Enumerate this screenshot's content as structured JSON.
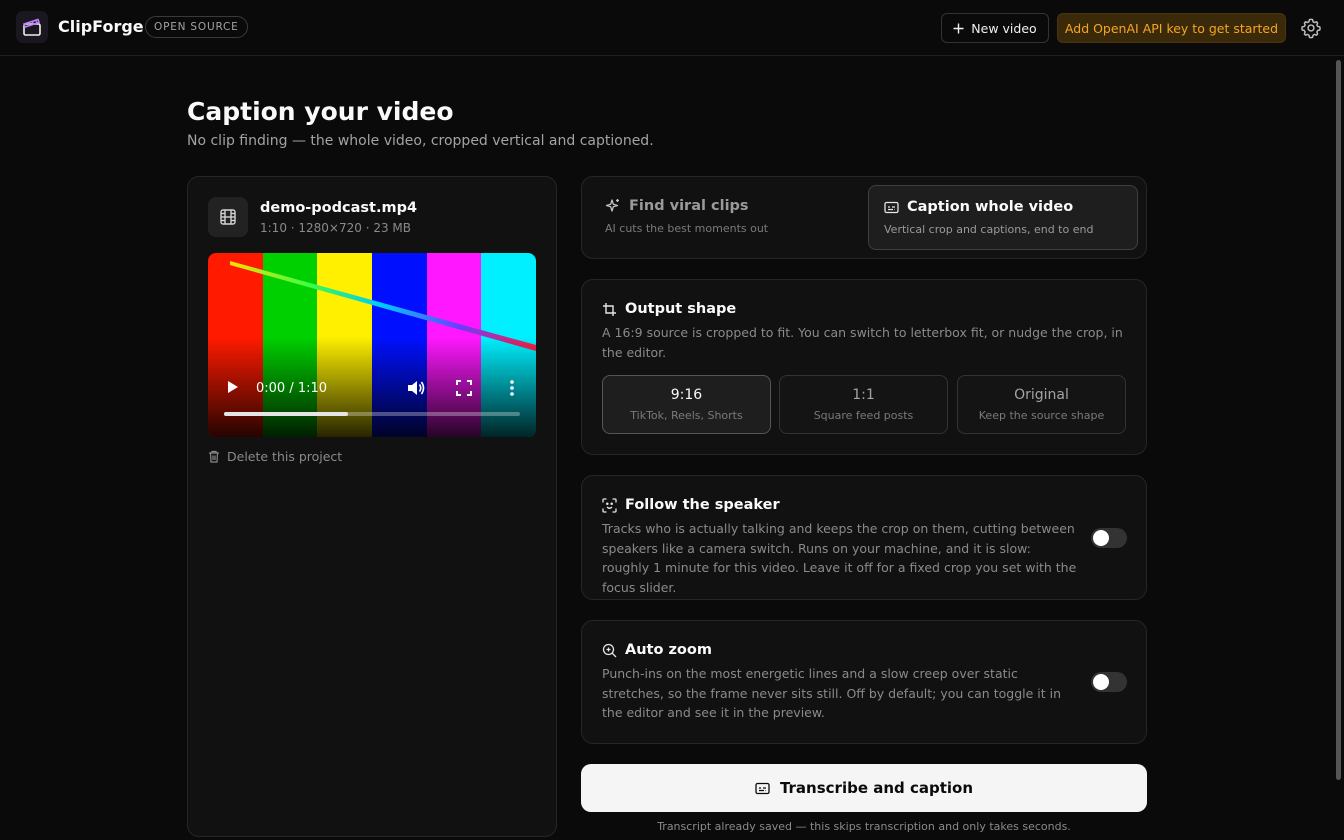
{
  "header": {
    "brand": "ClipForge",
    "badge": "OPEN SOURCE",
    "new_video_label": "New video",
    "api_key_label": "Add OpenAI API key to get started"
  },
  "page": {
    "title": "Caption your video",
    "subtitle": "No clip finding — the whole video, cropped vertical and captioned."
  },
  "file": {
    "name": "demo-podcast.mp4",
    "meta": "1:10 · 1280×720 · 23 MB",
    "player_time": "0:00 / 1:10",
    "progress_fraction": 0.42,
    "delete_label": "Delete this project"
  },
  "modes": [
    {
      "title": "Find viral clips",
      "desc": "AI cuts the best moments out",
      "selected": false
    },
    {
      "title": "Caption whole video",
      "desc": "Vertical crop and captions, end to end",
      "selected": true
    }
  ],
  "output_shape": {
    "title": "Output shape",
    "desc": "A 16:9 source is cropped to fit. You can switch to letterbox fit, or nudge the crop, in the editor.",
    "options": [
      {
        "label": "9:16",
        "sub": "TikTok, Reels, Shorts",
        "selected": true
      },
      {
        "label": "1:1",
        "sub": "Square feed posts",
        "selected": false
      },
      {
        "label": "Original",
        "sub": "Keep the source shape",
        "selected": false
      }
    ]
  },
  "follow_speaker": {
    "title": "Follow the speaker",
    "desc": "Tracks who is actually talking and keeps the crop on them, cutting between speakers like a camera switch. Runs on your machine, and it is slow: roughly 1 minute for this video. Leave it off for a fixed crop you set with the focus slider.",
    "enabled": false
  },
  "auto_zoom": {
    "title": "Auto zoom",
    "desc": "Punch-ins on the most energetic lines and a slow creep over static stretches, so the frame never sits still. Off by default; you can toggle it in the editor and see it in the preview.",
    "enabled": false
  },
  "cta": {
    "label": "Transcribe and caption",
    "note": "Transcript already saved — this skips transcription and only takes seconds."
  },
  "colors": {
    "accent_warning": "#f5a524",
    "bar_red": "#ff1a00",
    "bar_green": "#00d000",
    "bar_yellow": "#fff000",
    "bar_blue": "#0010ff",
    "bar_magenta": "#ff18ff",
    "bar_cyan": "#00f0ff"
  }
}
